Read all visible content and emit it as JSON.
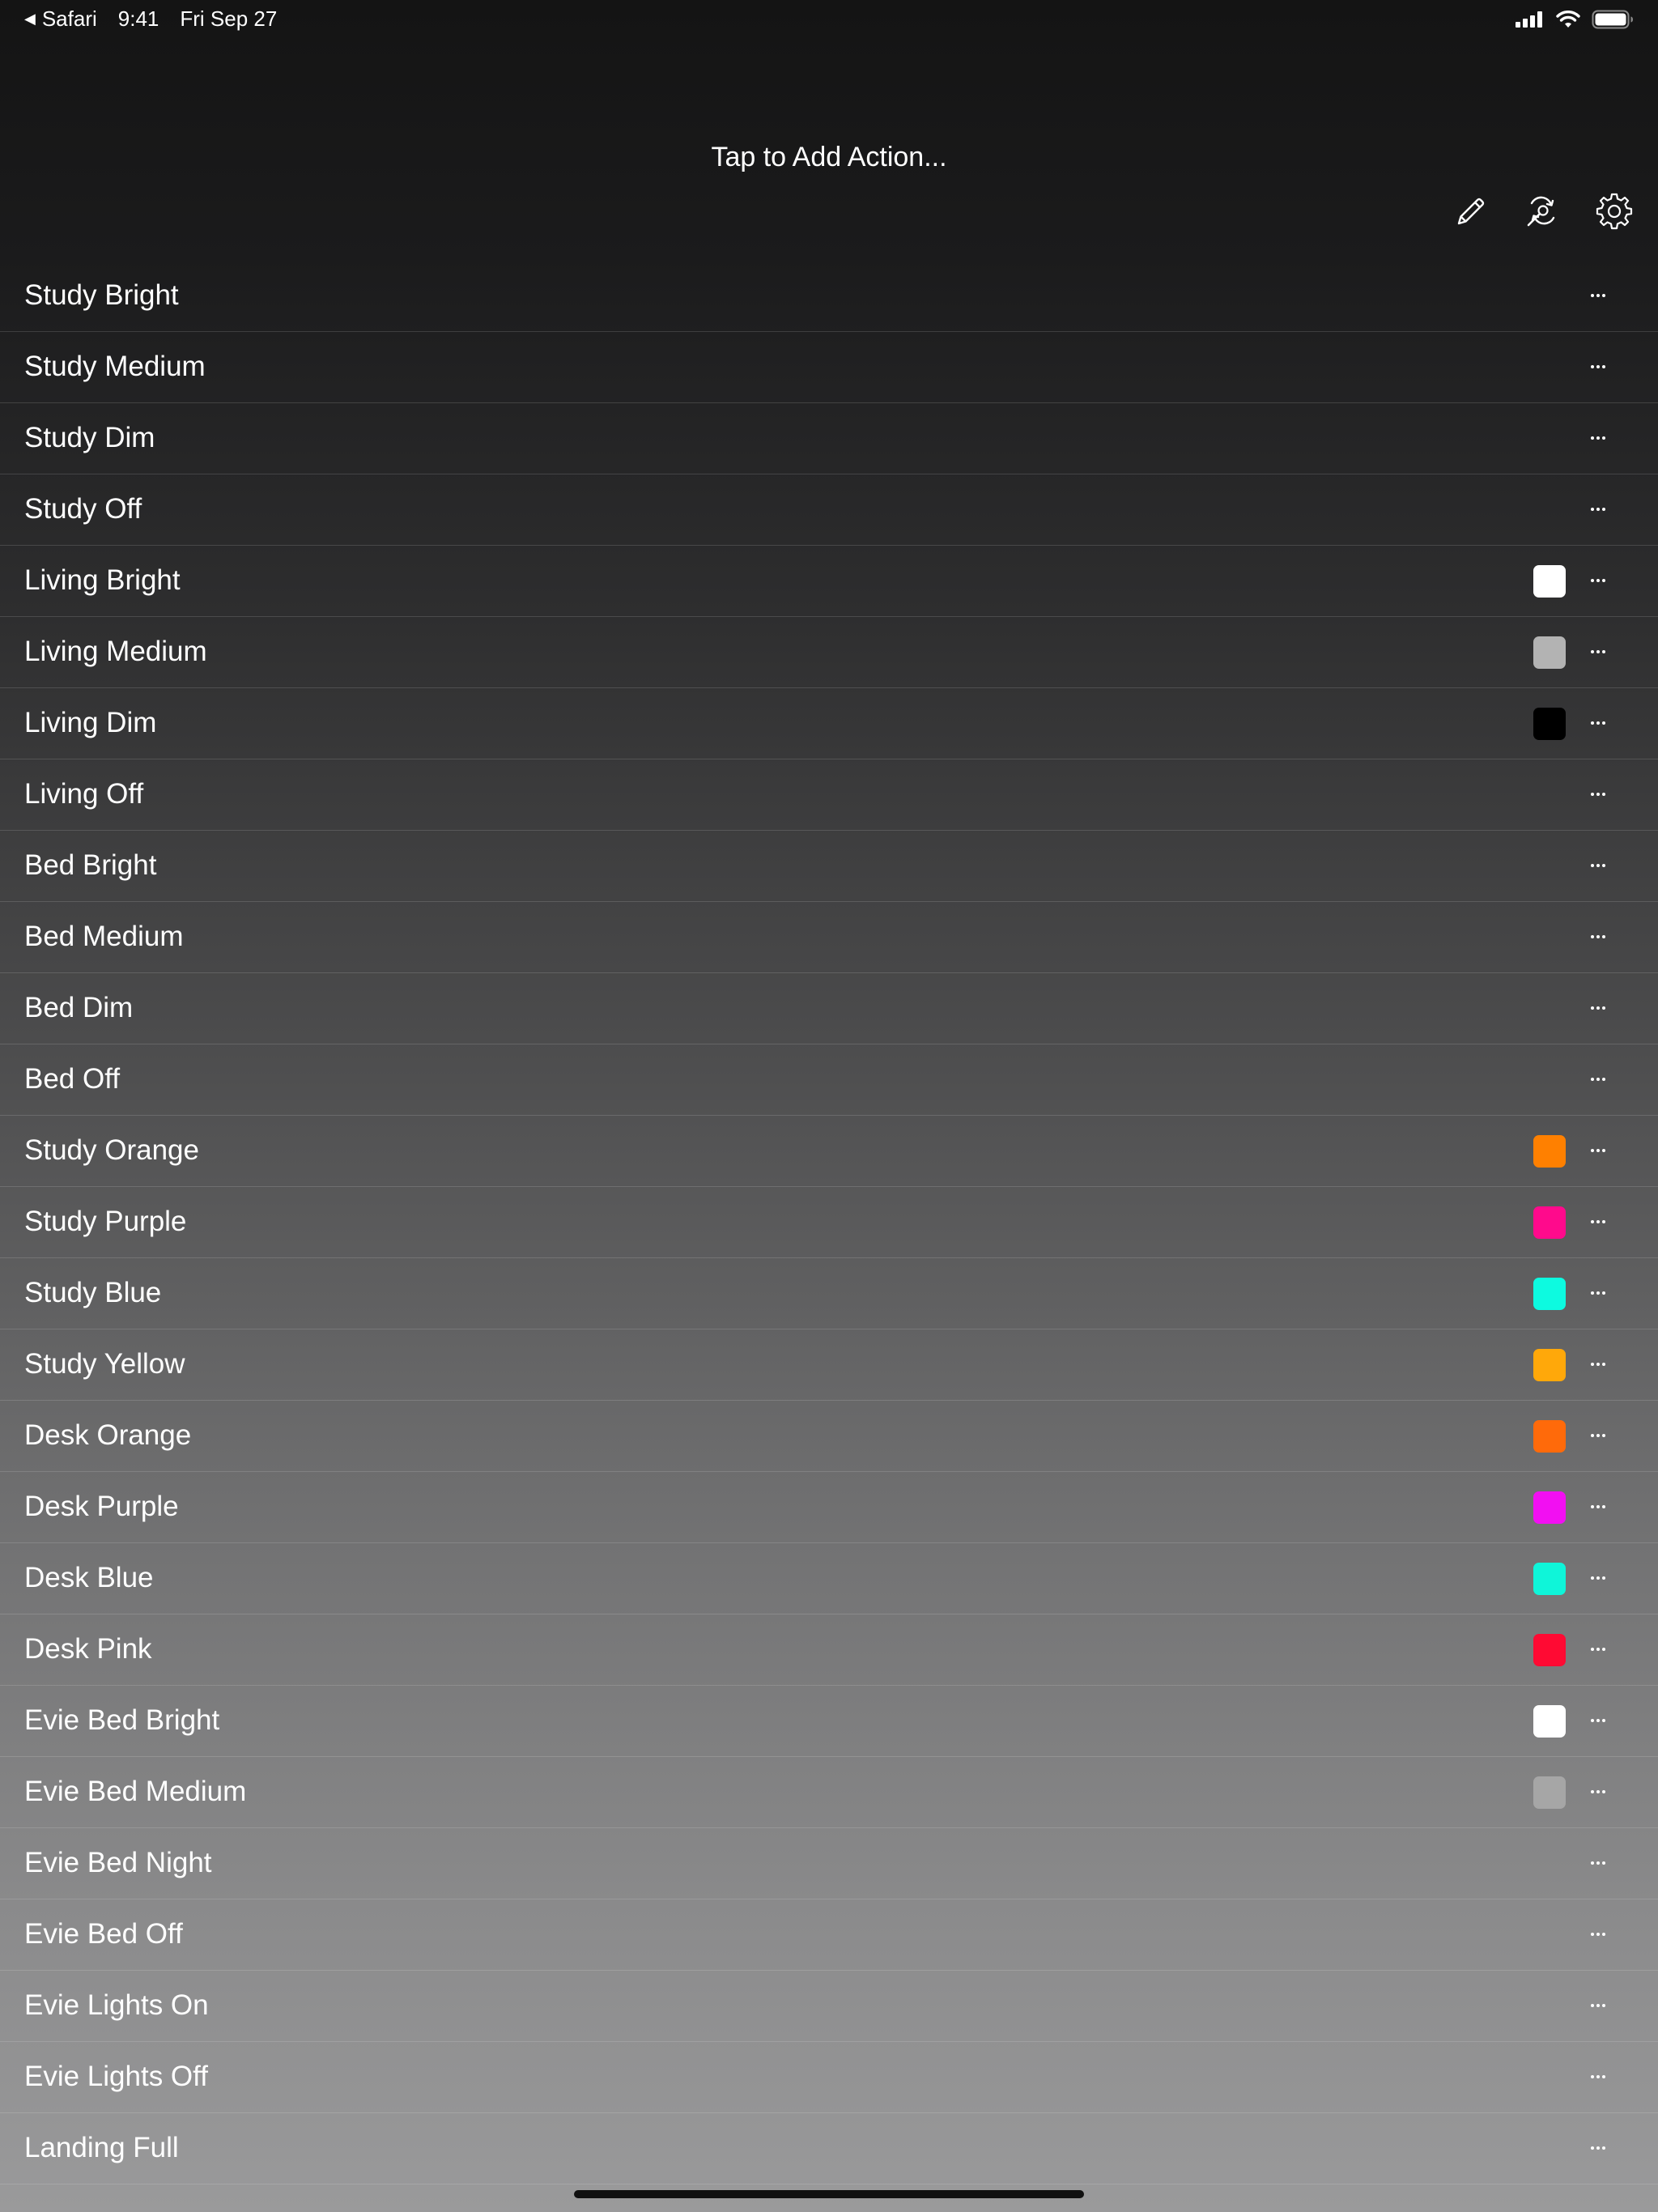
{
  "status_bar": {
    "back_app": "Safari",
    "time": "9:41",
    "date": "Fri Sep 27",
    "icons": [
      "back-arrow-icon",
      "cellular-signal-icon",
      "wifi-icon",
      "battery-icon"
    ]
  },
  "header": {
    "title": "Tap to Add Action..."
  },
  "toolbar": {
    "icons": [
      "pencil-icon",
      "search-refresh-icon",
      "gear-icon"
    ]
  },
  "actions": [
    {
      "label": "Study Bright",
      "color": null
    },
    {
      "label": "Study Medium",
      "color": null
    },
    {
      "label": "Study Dim",
      "color": null
    },
    {
      "label": "Study Off",
      "color": null
    },
    {
      "label": "Living Bright",
      "color": "#ffffff"
    },
    {
      "label": "Living Medium",
      "color": "#b3b3b3"
    },
    {
      "label": "Living Dim",
      "color": "#000000"
    },
    {
      "label": "Living Off",
      "color": null
    },
    {
      "label": "Bed Bright",
      "color": null
    },
    {
      "label": "Bed Medium",
      "color": null
    },
    {
      "label": "Bed Dim",
      "color": null
    },
    {
      "label": "Bed Off",
      "color": null
    },
    {
      "label": "Study Orange",
      "color": "#ff8000"
    },
    {
      "label": "Study Purple",
      "color": "#ff0a8c"
    },
    {
      "label": "Study Blue",
      "color": "#0dfae0"
    },
    {
      "label": "Study Yellow",
      "color": "#ffa80a"
    },
    {
      "label": "Desk Orange",
      "color": "#ff6a0a"
    },
    {
      "label": "Desk Purple",
      "color": "#f20ff2"
    },
    {
      "label": "Desk Blue",
      "color": "#0ff5d9"
    },
    {
      "label": "Desk Pink",
      "color": "#ff0a33"
    },
    {
      "label": "Evie Bed Bright",
      "color": "#ffffff"
    },
    {
      "label": "Evie Bed Medium",
      "color": "#a6a6a6"
    },
    {
      "label": "Evie Bed Night",
      "color": null
    },
    {
      "label": "Evie Bed Off",
      "color": null
    },
    {
      "label": "Evie Lights On",
      "color": null
    },
    {
      "label": "Evie Lights Off",
      "color": null
    },
    {
      "label": "Landing Full",
      "color": null
    }
  ],
  "row_more_icon": "more-ellipsis-icon"
}
